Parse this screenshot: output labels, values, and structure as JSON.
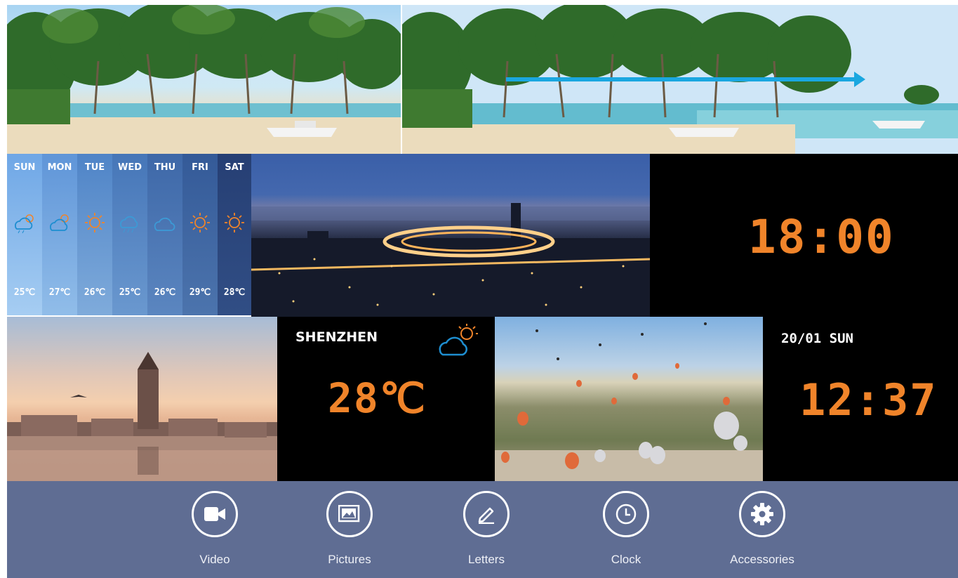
{
  "weekly_forecast": [
    {
      "day": "SUN",
      "temp": "25℃",
      "icon": "rain-sun-icon"
    },
    {
      "day": "MON",
      "temp": "27℃",
      "icon": "cloud-sun-icon"
    },
    {
      "day": "TUE",
      "temp": "26℃",
      "icon": "sun-icon"
    },
    {
      "day": "WED",
      "temp": "25℃",
      "icon": "rain-icon"
    },
    {
      "day": "THU",
      "temp": "26℃",
      "icon": "cloud-icon"
    },
    {
      "day": "FRI",
      "temp": "29℃",
      "icon": "sun-icon"
    },
    {
      "day": "SAT",
      "temp": "28℃",
      "icon": "sun-icon"
    }
  ],
  "clock_large": "18:00",
  "weather_card": {
    "city": "SHENZHEN",
    "temp": "28℃",
    "icon": "cloud-sun-icon"
  },
  "date_clock": {
    "date": "20/01 SUN",
    "time": "12:37"
  },
  "toolbar": {
    "video": "Video",
    "pictures": "Pictures",
    "letters": "Letters",
    "clock": "Clock",
    "accessories": "Accessories"
  },
  "colors": {
    "digital": "#f0842a",
    "toolbar_bg": "#5f6d93",
    "arrow": "#1aa7e0"
  }
}
